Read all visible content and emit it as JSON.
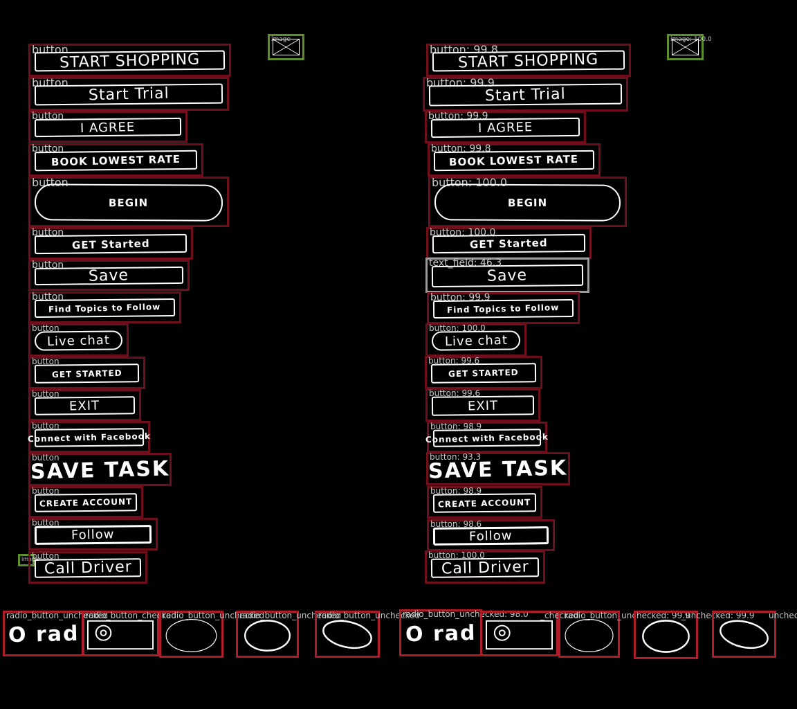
{
  "left": {
    "buttons": [
      {
        "label": "button",
        "text": "START SHOPPING"
      },
      {
        "label": "button",
        "text": "Start Trial"
      },
      {
        "label": "button",
        "text": "I AGREE"
      },
      {
        "label": "button",
        "text": "BOOK LOWEST RATE"
      },
      {
        "label": "button",
        "text": "BEGIN"
      },
      {
        "label": "button",
        "text": "GET Started"
      },
      {
        "label": "button",
        "text": "Save"
      },
      {
        "label": "button",
        "text": "Find Topics to Follow"
      },
      {
        "label": "button",
        "text": "Live chat"
      },
      {
        "label": "button",
        "text": "GET STARTED"
      },
      {
        "label": "button",
        "text": "EXIT"
      },
      {
        "label": "button",
        "text": "Connect with Facebook"
      },
      {
        "label": "button",
        "text": "SAVE TASK"
      },
      {
        "label": "button",
        "text": "CREATE ACCOUNT"
      },
      {
        "label": "button",
        "text": "Follow"
      },
      {
        "label": "button",
        "text": "Call Driver"
      }
    ],
    "image_top": {
      "label": "image"
    },
    "image_side": {
      "label": "image"
    },
    "radios": [
      {
        "label": "radio_button_unchecked",
        "text": "O rad"
      },
      {
        "label": "radio_button_checked"
      },
      {
        "label": "radio_button_unchecked"
      },
      {
        "label": "radio_button_unchecked"
      },
      {
        "label": "radio_button_unchecked"
      }
    ]
  },
  "right": {
    "buttons": [
      {
        "label": "button: 99.8",
        "text": "START SHOPPING"
      },
      {
        "label": "button: 99.9",
        "text": "Start Trial"
      },
      {
        "label": "button: 99.9",
        "text": "I AGREE"
      },
      {
        "label": "button: 99.8",
        "text": "BOOK LOWEST RATE"
      },
      {
        "label": "button: 100.0",
        "text": "BEGIN"
      },
      {
        "label": "button: 100.0",
        "text": "GET Started"
      },
      {
        "label": "text_field: 46.3",
        "text": "Save"
      },
      {
        "label": "button: 99.9",
        "text": "Find Topics to Follow"
      },
      {
        "label": "button: 100.0",
        "text": "Live chat"
      },
      {
        "label": "button: 99.6",
        "text": "GET STARTED"
      },
      {
        "label": "button: 99.6",
        "text": "EXIT"
      },
      {
        "label": "button: 98.9",
        "text": "Connect with Facebook"
      },
      {
        "label": "button: 93.3",
        "text": "SAVE TASK"
      },
      {
        "label": "button: 98.9",
        "text": "CREATE ACCOUNT"
      },
      {
        "label": "button: 98.6",
        "text": "Follow"
      },
      {
        "label": "button: 100.0",
        "text": "Call Driver"
      }
    ],
    "image_top": {
      "label": "image: 100.0"
    },
    "radios": [
      {
        "label": "radio_button_unchecked: 98.0",
        "text": "O rad"
      },
      {
        "label": "_checked"
      },
      {
        "label": "radio_button_unchecked: 99.9"
      },
      {
        "label": "_unchecked: 99.9"
      },
      {
        "label": "unchecked"
      }
    ]
  }
}
